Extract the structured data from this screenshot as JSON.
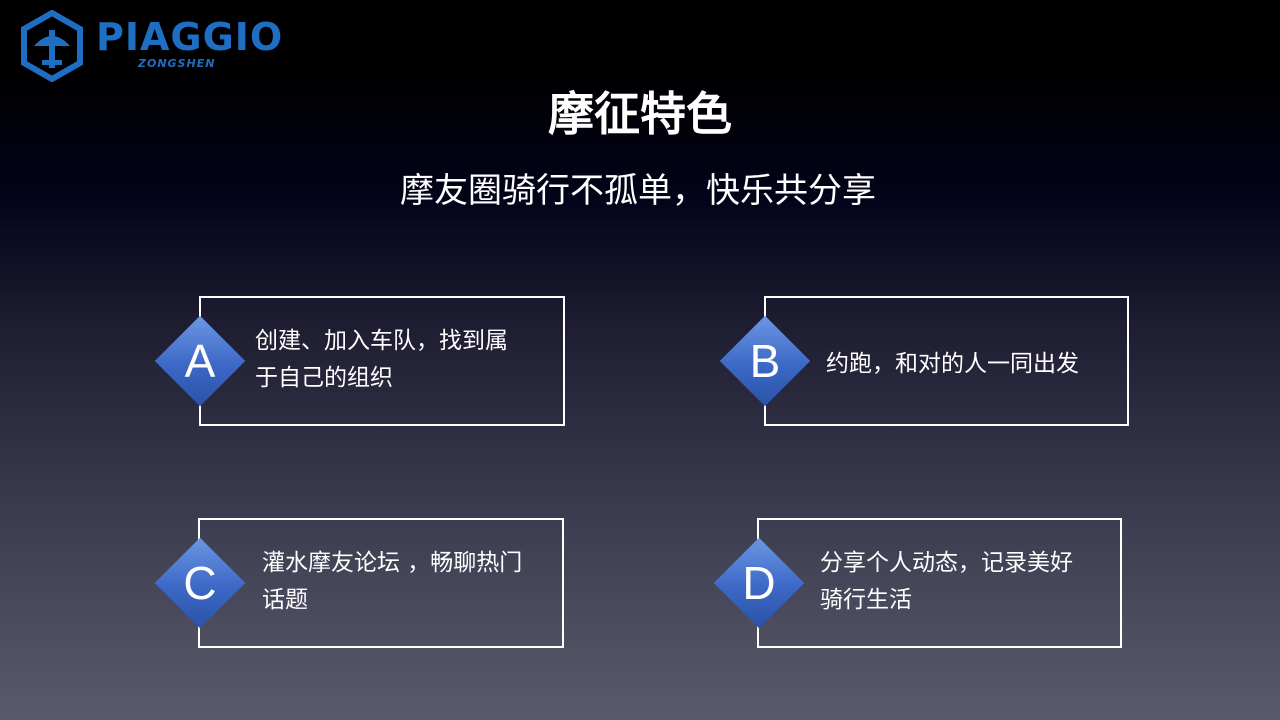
{
  "logo": {
    "brand": "PIAGGIO",
    "sub": "ZONGSHEN",
    "color": "#1e6fc4"
  },
  "header": {
    "title": "摩征特色",
    "subtitle": "摩友圈骑行不孤单，快乐共分享"
  },
  "features": [
    {
      "letter": "A",
      "line1": "创建、加入车队，找到属",
      "line2": "于自己的组织"
    },
    {
      "letter": "B",
      "line1": "约跑，和对的人一同出发",
      "line2": ""
    },
    {
      "letter": "C",
      "line1": "灌水摩友论坛 ，畅聊热门",
      "line2": "话题"
    },
    {
      "letter": "D",
      "line1": "分享个人动态，记录美好",
      "line2": "骑行生活"
    }
  ],
  "colors": {
    "diamond": "#3c68c6",
    "box_border": "#ffffff",
    "background_bottom": "#5a5a6c"
  }
}
